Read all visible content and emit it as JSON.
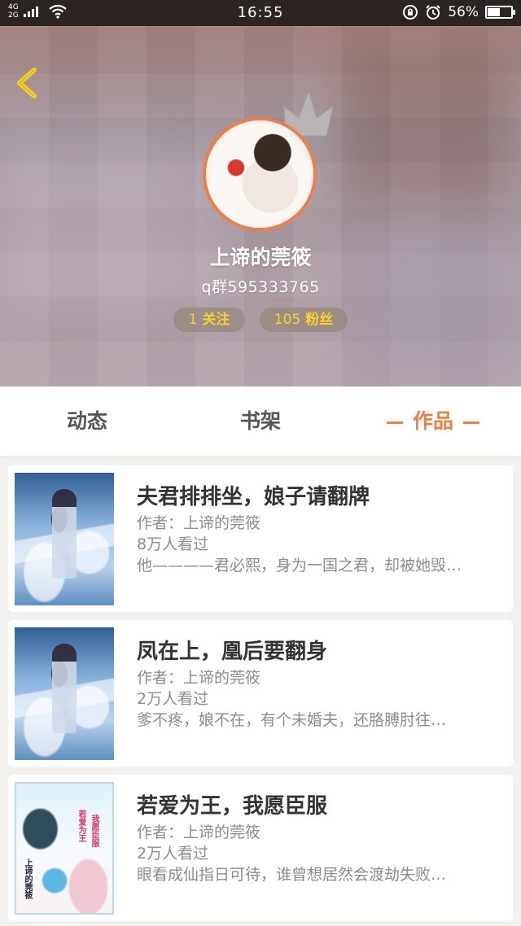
{
  "status_bar": {
    "network_top": "4G",
    "network_bottom": "2G",
    "time": "16:55",
    "battery": "56%",
    "battery_level": 0.56
  },
  "profile": {
    "name": "上谛的莞筱",
    "description": "q群595333765",
    "follow_count": "1",
    "follow_label": "关注",
    "fans_count": "105",
    "fans_label": "粉丝",
    "avatar_border_color": "#ef7f47"
  },
  "tabs": [
    {
      "label": "动态",
      "active": false
    },
    {
      "label": "书架",
      "active": false
    },
    {
      "label": "作品",
      "active": true
    }
  ],
  "accent_color": "#ef7f47",
  "books": [
    {
      "title": "夫君排排坐，娘子请翻牌",
      "author": "作者：上谛的莞筱",
      "views": "8万人看过",
      "summary": "他————君必熙，身为一国之君，却被她毁…",
      "cover_icon": "book-cover-image"
    },
    {
      "title": "凤在上，凰后要翻身",
      "author": "作者：上谛的莞筱",
      "views": "2万人看过",
      "summary": "爹不疼，娘不在，有个未婚夫，还胳膊肘往…",
      "cover_icon": "book-cover-image"
    },
    {
      "title": "若爱为王，我愿臣服",
      "author": "作者：上谛的莞筱",
      "views": "2万人看过",
      "summary": "眼看成仙指日可待，谁曾想居然会渡劫失败…",
      "cover_icon": "book-cover-image",
      "cover_text": [
        "若爱为王",
        "我愿臣服",
        "上谛的莞筱"
      ]
    }
  ]
}
